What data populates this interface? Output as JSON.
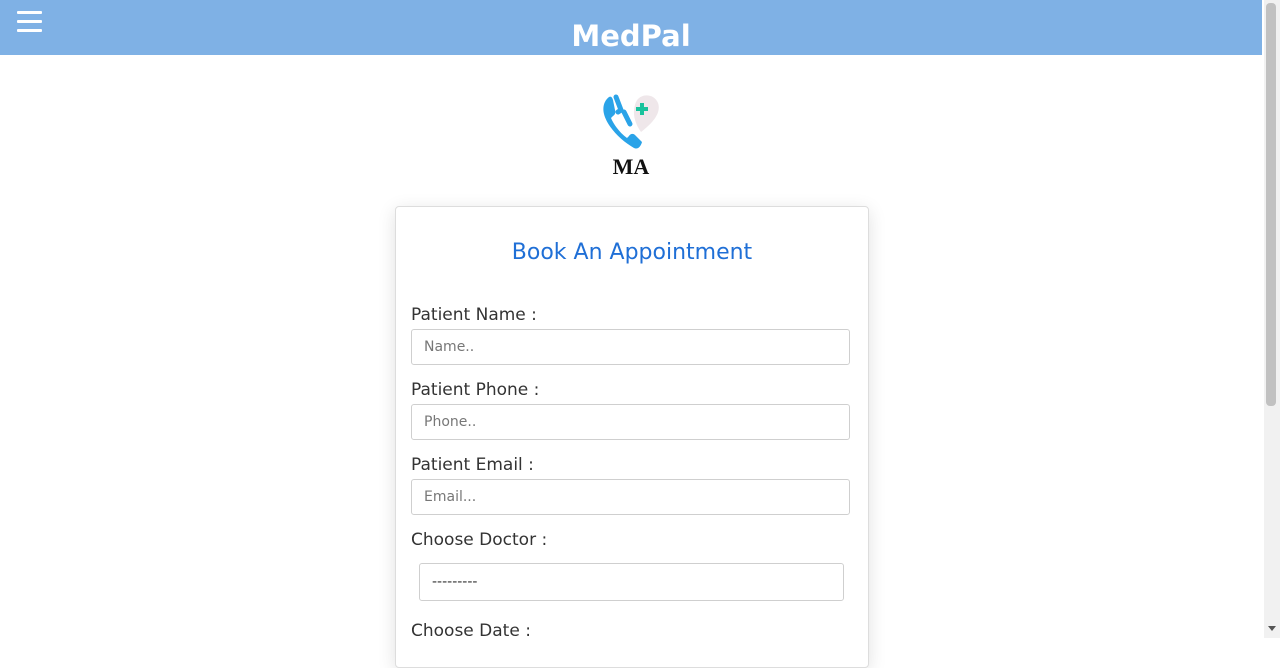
{
  "app": {
    "title": "MedPal"
  },
  "logo": {
    "text": "MA"
  },
  "form": {
    "title": "Book An Appointment",
    "patient_name_label": "Patient Name :",
    "patient_name_placeholder": "Name..",
    "patient_phone_label": "Patient Phone :",
    "patient_phone_placeholder": "Phone..",
    "patient_email_label": "Patient Email :",
    "patient_email_placeholder": "Email...",
    "doctor_label": "Choose Doctor :",
    "doctor_selected": "---------",
    "date_label": "Choose Date :"
  },
  "icons": {
    "menu": "hamburger-menu-icon",
    "logo": "phone-heart-logo-icon"
  },
  "colors": {
    "header": "#7fb1e5",
    "title": "#1f6fd6",
    "logo_blue": "#2aa3e8",
    "logo_plus": "#18c29c"
  }
}
